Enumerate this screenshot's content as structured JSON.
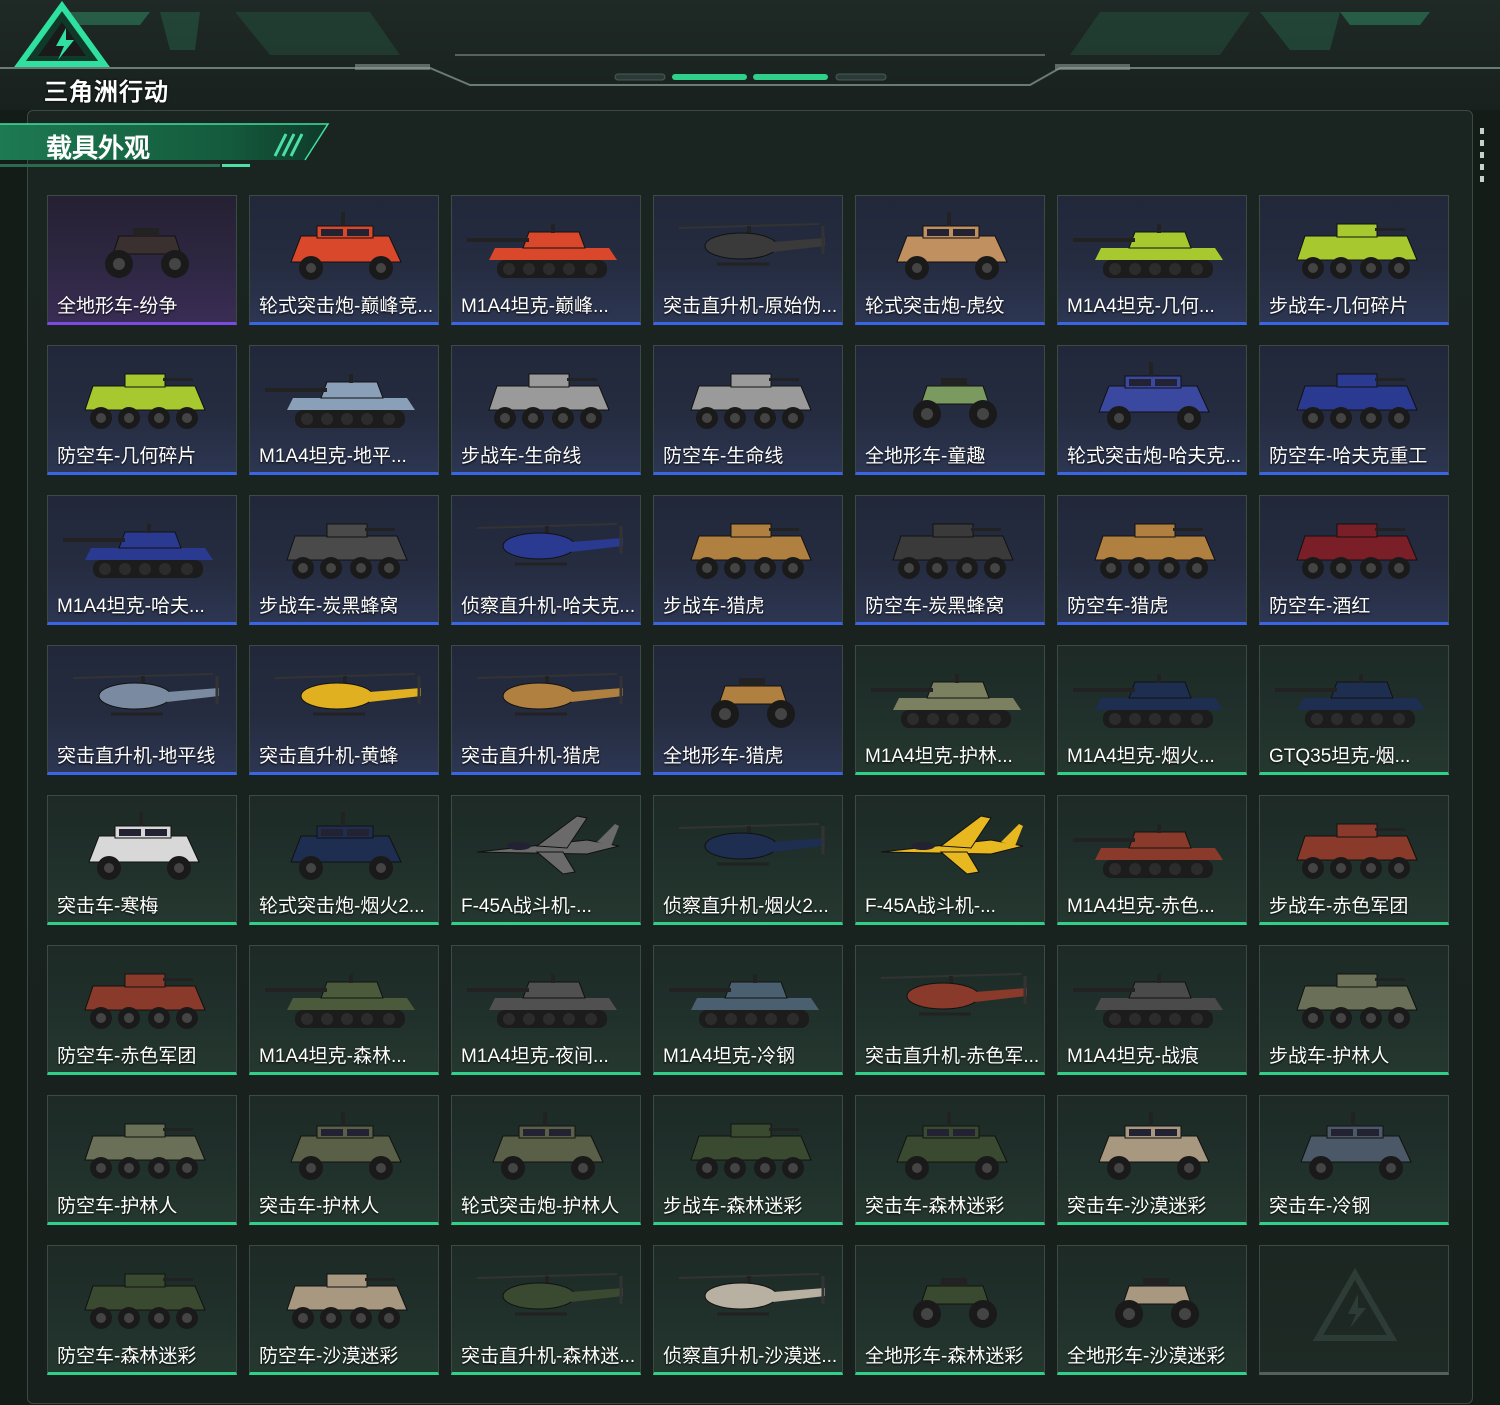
{
  "app": {
    "logo_text": "三角洲行动"
  },
  "section": {
    "title": "载具外观"
  },
  "colors": {
    "purple": "#7b4ae0",
    "blue": "#3a66e6",
    "green": "#2fd18a",
    "accent": "#2fd18a"
  },
  "skins": [
    {
      "label": "全地形车-纷争",
      "rarity": "purple",
      "kind": "atv",
      "tint": "#3a3030"
    },
    {
      "label": "轮式突击炮-巅峰竞...",
      "rarity": "blue",
      "kind": "car",
      "tint": "#d9482a"
    },
    {
      "label": "M1A4坦克-巅峰...",
      "rarity": "blue",
      "kind": "tank",
      "tint": "#d9482a"
    },
    {
      "label": "突击直升机-原始伪...",
      "rarity": "blue",
      "kind": "heli",
      "tint": "#3a3a3a"
    },
    {
      "label": "轮式突击炮-虎纹",
      "rarity": "blue",
      "kind": "car",
      "tint": "#c09060"
    },
    {
      "label": "M1A4坦克-几何...",
      "rarity": "blue",
      "kind": "tank",
      "tint": "#a8c830"
    },
    {
      "label": "步战车-几何碎片",
      "rarity": "blue",
      "kind": "apc",
      "tint": "#a8c830"
    },
    {
      "label": "防空车-几何碎片",
      "rarity": "blue",
      "kind": "apc",
      "tint": "#a8c830"
    },
    {
      "label": "M1A4坦克-地平...",
      "rarity": "blue",
      "kind": "tank",
      "tint": "#8aa0b8"
    },
    {
      "label": "步战车-生命线",
      "rarity": "blue",
      "kind": "apc",
      "tint": "#9a9a9a"
    },
    {
      "label": "防空车-生命线",
      "rarity": "blue",
      "kind": "apc",
      "tint": "#9a9a9a"
    },
    {
      "label": "全地形车-童趣",
      "rarity": "blue",
      "kind": "atv",
      "tint": "#7a9a60"
    },
    {
      "label": "轮式突击炮-哈夫克...",
      "rarity": "blue",
      "kind": "car",
      "tint": "#3a48a0"
    },
    {
      "label": "防空车-哈夫克重工",
      "rarity": "blue",
      "kind": "apc",
      "tint": "#2a3a90"
    },
    {
      "label": "M1A4坦克-哈夫...",
      "rarity": "blue",
      "kind": "tank",
      "tint": "#2a3a90"
    },
    {
      "label": "步战车-炭黑蜂窝",
      "rarity": "blue",
      "kind": "apc",
      "tint": "#4a4a4a"
    },
    {
      "label": "侦察直升机-哈夫克...",
      "rarity": "blue",
      "kind": "heli",
      "tint": "#2a3a90"
    },
    {
      "label": "步战车-猎虎",
      "rarity": "blue",
      "kind": "apc",
      "tint": "#b08040"
    },
    {
      "label": "防空车-炭黑蜂窝",
      "rarity": "blue",
      "kind": "apc",
      "tint": "#3a3a3a"
    },
    {
      "label": "防空车-猎虎",
      "rarity": "blue",
      "kind": "apc",
      "tint": "#b08040"
    },
    {
      "label": "防空车-酒红",
      "rarity": "blue",
      "kind": "apc",
      "tint": "#7a1e28"
    },
    {
      "label": "突击直升机-地平线",
      "rarity": "blue",
      "kind": "heli",
      "tint": "#7a8aa0"
    },
    {
      "label": "突击直升机-黄蜂",
      "rarity": "blue",
      "kind": "heli",
      "tint": "#e0b020"
    },
    {
      "label": "突击直升机-猎虎",
      "rarity": "blue",
      "kind": "heli",
      "tint": "#b08040"
    },
    {
      "label": "全地形车-猎虎",
      "rarity": "blue",
      "kind": "atv",
      "tint": "#b08040"
    },
    {
      "label": "M1A4坦克-护林...",
      "rarity": "green",
      "kind": "tank",
      "tint": "#7a8060"
    },
    {
      "label": "M1A4坦克-烟火...",
      "rarity": "green",
      "kind": "tank",
      "tint": "#1e2e50"
    },
    {
      "label": "GTQ35坦克-烟...",
      "rarity": "green",
      "kind": "tank",
      "tint": "#1e2e50"
    },
    {
      "label": "突击车-寒梅",
      "rarity": "green",
      "kind": "car",
      "tint": "#d8d8d8"
    },
    {
      "label": "轮式突击炮-烟火2...",
      "rarity": "green",
      "kind": "car",
      "tint": "#1e2e50"
    },
    {
      "label": "F-45A战斗机-...",
      "rarity": "green",
      "kind": "jet",
      "tint": "#6a6a6a"
    },
    {
      "label": "侦察直升机-烟火2...",
      "rarity": "green",
      "kind": "heli",
      "tint": "#1e2e50"
    },
    {
      "label": "F-45A战斗机-...",
      "rarity": "green",
      "kind": "jet",
      "tint": "#e8b820"
    },
    {
      "label": "M1A4坦克-赤色...",
      "rarity": "green",
      "kind": "tank",
      "tint": "#8a3a2a"
    },
    {
      "label": "步战车-赤色军团",
      "rarity": "green",
      "kind": "apc",
      "tint": "#8a3a2a"
    },
    {
      "label": "防空车-赤色军团",
      "rarity": "green",
      "kind": "apc",
      "tint": "#8a3a2a"
    },
    {
      "label": "M1A4坦克-森林...",
      "rarity": "green",
      "kind": "tank",
      "tint": "#4a5a3a"
    },
    {
      "label": "M1A4坦克-夜间...",
      "rarity": "green",
      "kind": "tank",
      "tint": "#505050"
    },
    {
      "label": "M1A4坦克-冷钢",
      "rarity": "green",
      "kind": "tank",
      "tint": "#4a6070"
    },
    {
      "label": "突击直升机-赤色军...",
      "rarity": "green",
      "kind": "heli",
      "tint": "#8a3a2a"
    },
    {
      "label": "M1A4坦克-战痕",
      "rarity": "green",
      "kind": "tank",
      "tint": "#4a4a4a"
    },
    {
      "label": "步战车-护林人",
      "rarity": "green",
      "kind": "apc",
      "tint": "#6a7058"
    },
    {
      "label": "防空车-护林人",
      "rarity": "green",
      "kind": "apc",
      "tint": "#6a7058"
    },
    {
      "label": "突击车-护林人",
      "rarity": "green",
      "kind": "car",
      "tint": "#5a6048"
    },
    {
      "label": "轮式突击炮-护林人",
      "rarity": "green",
      "kind": "car",
      "tint": "#5a6048"
    },
    {
      "label": "步战车-森林迷彩",
      "rarity": "green",
      "kind": "apc",
      "tint": "#3a4a30"
    },
    {
      "label": "突击车-森林迷彩",
      "rarity": "green",
      "kind": "car",
      "tint": "#3a4a30"
    },
    {
      "label": "突击车-沙漠迷彩",
      "rarity": "green",
      "kind": "car",
      "tint": "#a89880"
    },
    {
      "label": "突击车-冷钢",
      "rarity": "green",
      "kind": "car",
      "tint": "#4a5868"
    },
    {
      "label": "防空车-森林迷彩",
      "rarity": "green",
      "kind": "apc",
      "tint": "#3a4a30"
    },
    {
      "label": "防空车-沙漠迷彩",
      "rarity": "green",
      "kind": "apc",
      "tint": "#a89880"
    },
    {
      "label": "突击直升机-森林迷...",
      "rarity": "green",
      "kind": "heli",
      "tint": "#3a4a30"
    },
    {
      "label": "侦察直升机-沙漠迷...",
      "rarity": "green",
      "kind": "heli",
      "tint": "#b8b0a0"
    },
    {
      "label": "全地形车-森林迷彩",
      "rarity": "green",
      "kind": "atv",
      "tint": "#3a4a30"
    },
    {
      "label": "全地形车-沙漠迷彩",
      "rarity": "green",
      "kind": "atv",
      "tint": "#a89880"
    },
    {
      "label": "",
      "rarity": "empty",
      "kind": "empty",
      "tint": "#2a3530"
    }
  ]
}
